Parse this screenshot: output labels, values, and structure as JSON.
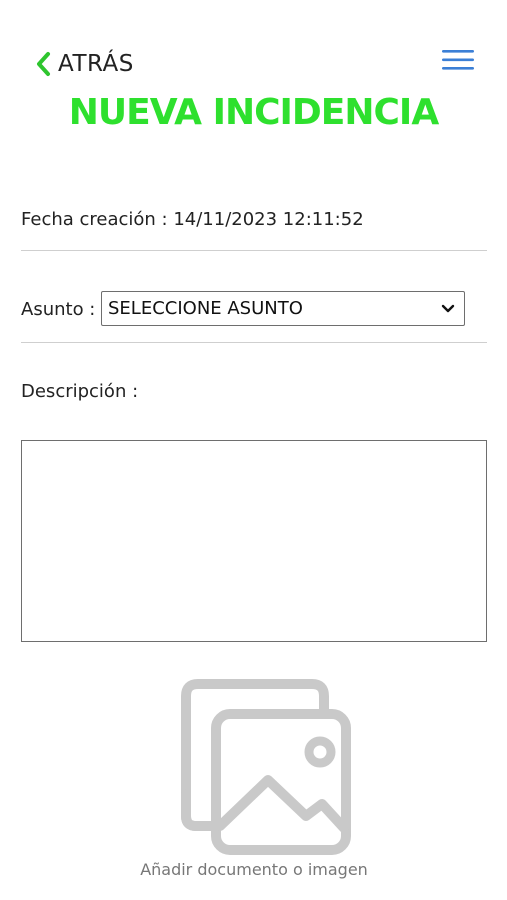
{
  "header": {
    "back_label": "ATRÁS",
    "title": "NUEVA INCIDENCIA",
    "menu_icon": "hamburger-menu-icon",
    "back_icon": "chevron-left-icon"
  },
  "form": {
    "date_row": "Fecha creación : 14/11/2023 12:11:52",
    "subject_label": "Asunto :",
    "subject_selected": "SELECCIONE ASUNTO",
    "description_label": "Descripción :",
    "description_value": ""
  },
  "attachment": {
    "label": "Añadir documento o imagen",
    "icon": "image-gallery-icon"
  },
  "colors": {
    "title_green": "#2ee02e",
    "back_chevron_green": "#2ec52e",
    "menu_blue": "#3b7fd6",
    "icon_gray": "#c9c9c9"
  }
}
